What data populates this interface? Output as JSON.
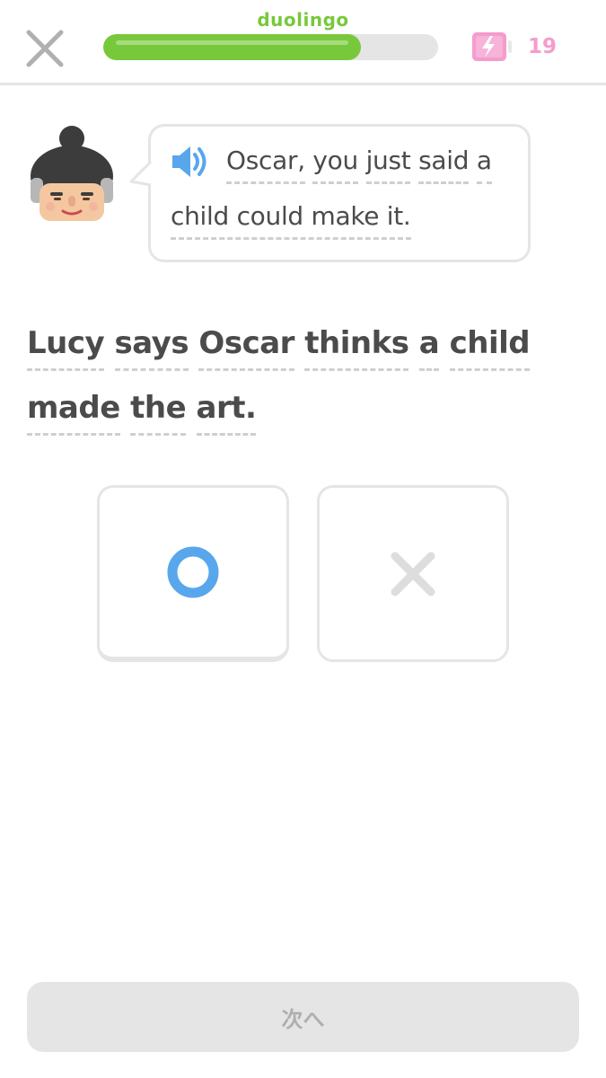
{
  "header": {
    "brand": "duolingo",
    "progress_fraction": 0.77,
    "energy_count": "19",
    "close_icon": "close-icon",
    "energy_icon": "energy-battery-icon"
  },
  "prompt": {
    "speaker_icon": "speaker-icon",
    "line1": [
      "Oscar,",
      "you",
      "just",
      "said",
      "a"
    ],
    "line2": [
      "child could make it."
    ]
  },
  "statement": {
    "line1": [
      "Lucy",
      "says",
      "Oscar",
      "thinks",
      "a",
      "child"
    ],
    "line2": [
      "made",
      "the",
      "art."
    ]
  },
  "choices": {
    "true_icon": "circle-icon",
    "false_icon": "cross-icon"
  },
  "footer": {
    "next_label": "次へ"
  },
  "colors": {
    "brand_green": "#78c83c",
    "energy_pink": "#f49ccd",
    "true_blue": "#58a7ec",
    "false_grey": "#dddddd",
    "text": "#4b4b4b"
  }
}
